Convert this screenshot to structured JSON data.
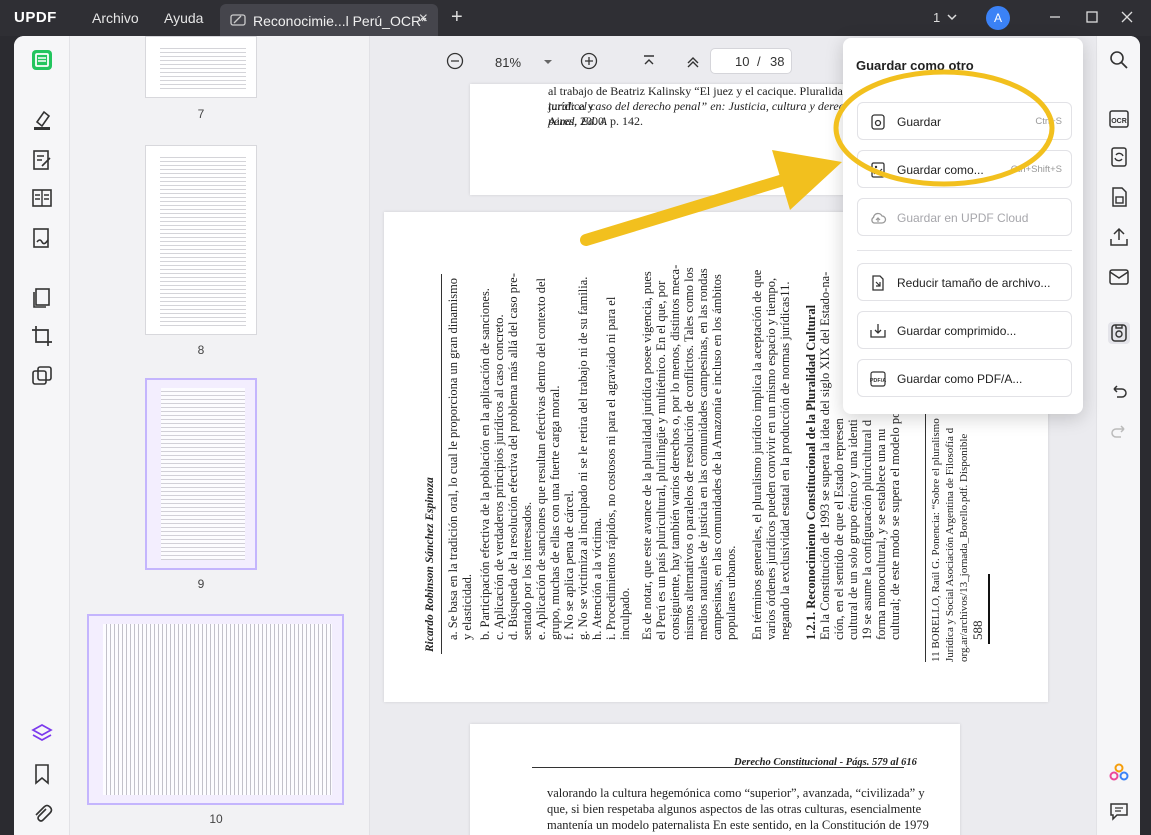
{
  "app": {
    "logo": "UPDF",
    "menu": [
      "Archivo",
      "Ayuda"
    ],
    "tab_title": "Reconocimie...l Perú_OCR*",
    "page_indicator": "1",
    "avatar_initial": "A"
  },
  "thumbnails": [
    {
      "number": "7"
    },
    {
      "number": "8"
    },
    {
      "number": "9"
    },
    {
      "number": "10"
    }
  ],
  "toolbar": {
    "zoom": "81%",
    "current_page": "10",
    "separator": "/",
    "total_pages": "38"
  },
  "page_top": {
    "lines": [
      "al trabajo de Beatriz Kalinsky “El juez y el cacique. Pluralidad jurídica y",
      "tural: el caso del derecho penal” en: Justicia, cultura y derecho penal. Ed. A",
      "Aires, 2000. p. 142."
    ]
  },
  "page_rotated": {
    "columns": [
      "Ricardo Robinson Sánchez Espinoza",
      "a.   Se basa en la tradición oral, lo cual le proporciona un gran dinamismo",
      "      y elasticidad.",
      "b.   Participación efectiva de la población en la aplicación de sanciones.",
      "c.   Aplicación de verdaderos principios jurídicos al caso concreto.",
      "d.   Búsqueda de la resolución efectiva del problema más allá del caso pre-",
      "      sentado por los interesados.",
      "e.   Aplicación de sanciones que resultan efectivas dentro del contexto del",
      "      grupo, muchas de ellas con una fuerte carga moral.",
      "f.    No se aplica pena de cárcel.",
      "g.   No se victimiza al inculpado ni se le retira del trabajo ni de su familia.",
      "h.   Atención a la víctima.",
      "i.    Procedimientos rápidos, no costosos ni para el agraviado ni para el",
      "      inculpado.",
      "Es de notar, que este avance de la pluralidad jurídica posee vigencia, pues",
      "el Perú es un país pluricultural, plurilingüe y multiétnico. En el que, por",
      "consiguiente, hay también varios derechos o, por lo menos, distintos meca-",
      "nismos alternativos o paralelos de resolución de conflictos. Tales como los",
      "medios naturales de justicia en las comunidades campesinas, en las rondas",
      "campesinas, en las comunidades de la Amazonía e incluso en los ámbitos",
      "populares urbanos.",
      "En términos generales, el pluralismo jurídico implica la aceptación de que",
      "varios órdenes jurídicos pueden convivir en un mismo espacio y tiempo,",
      "negando la exclusividad estatal en la producción de normas jurídicas11.",
      "1.2.1. Reconocimiento Constitucional de la Pluralidad Cultural",
      "En la Constitución de 1993 se supera la idea del siglo XIX del Estado-na-",
      "ción, en el sentido de que el Estado represen",
      "cultural de un solo grupo étnico y una identi",
      "19 se asume la configuración pluricultural d",
      "forma monocultural, y se establece una nu",
      "cultural; de este modo se supera el modelo polít",
      "11  BORELLO, Raúl G. Ponencia: “Sobre el pluralismo",
      "      Jurídica y Social Asociación Argentina de Filosofía d",
      "      org.ar/archivos/13_jornada_Borello.pdf. Disponible",
      "588"
    ]
  },
  "page_bottom": {
    "header": "Derecho Constitucional - Págs. 579 al 616",
    "lines": [
      "valorando la cultura hegemónica como “superior”, avanzada, “civilizada” y",
      "que, si bien respetaba algunos aspectos de las otras culturas, esencialmente",
      "mantenía un modelo paternalista En este sentido, en la Constitución de 1979"
    ]
  },
  "save_menu": {
    "title": "Guardar como otro",
    "items": [
      {
        "label": "Guardar",
        "shortcut": "Ctrl+S",
        "icon": "save-icon",
        "enabled": true
      },
      {
        "label": "Guardar como...",
        "shortcut": "Ctrl+Shift+S",
        "icon": "save-as-icon",
        "enabled": true
      },
      {
        "label": "Guardar en UPDF Cloud",
        "shortcut": "",
        "icon": "cloud-icon",
        "enabled": false
      },
      {
        "label": "Reducir tamaño de archivo...",
        "shortcut": "",
        "icon": "compress-file-icon",
        "enabled": true
      },
      {
        "label": "Guardar comprimido...",
        "shortcut": "",
        "icon": "archive-icon",
        "enabled": true
      },
      {
        "label": "Guardar como PDF/A...",
        "shortcut": "",
        "icon": "pdfa-icon",
        "enabled": true
      }
    ]
  },
  "colors": {
    "accent": "#7c3aed",
    "highlight_annotation": "#f2c01e",
    "titlebar": "#2f2f34",
    "avatar": "#3b82f6"
  }
}
